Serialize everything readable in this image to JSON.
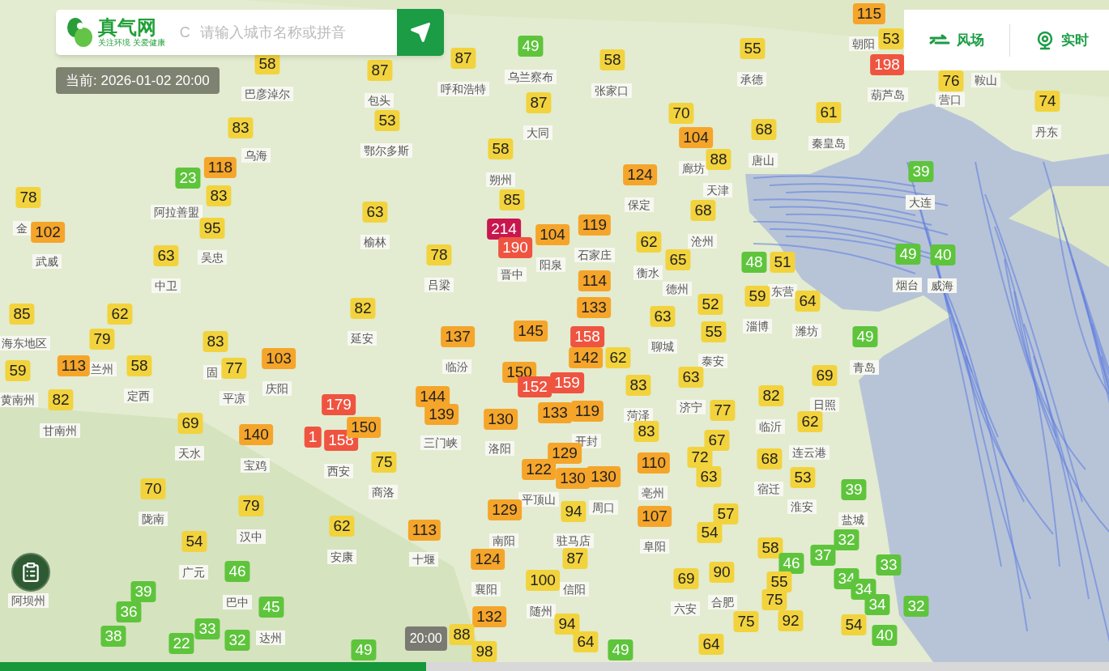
{
  "header": {
    "logo": "真气网",
    "tagline": "关注环境 关爱健康",
    "search_prefix": "C",
    "search_placeholder": "请输入城市名称或拼音"
  },
  "current_time": "当前: 2026-01-02 20:00",
  "toggles": [
    {
      "label": "风场",
      "kind": "wind"
    },
    {
      "label": "实时",
      "kind": "live"
    }
  ],
  "city_labels": [
    "朝阳",
    "乌兰察布",
    "承德",
    "鞍山",
    "巴彦淖尔",
    "包头",
    "呼和浩特",
    "张家口",
    "葫芦岛",
    "营口",
    "大同",
    "丹东",
    "秦皇岛",
    "乌海",
    "鄂尔多斯",
    "唐山",
    "廊坊",
    "朔州",
    "天津",
    "保定",
    "大连",
    "阿拉善盟",
    "金",
    "榆林",
    "沧州",
    "吴忠",
    "石家庄",
    "武威",
    "阳泉",
    "晋中",
    "衡水",
    "中卫",
    "吕梁",
    "德州",
    "东营",
    "烟台",
    "威海",
    "淄博",
    "潍坊",
    "海东地区",
    "延安",
    "聊城",
    "泰安",
    "兰州",
    "临汾",
    "青岛",
    "固",
    "庆阳",
    "黄南州",
    "定西",
    "平凉",
    "济宁",
    "日照",
    "菏泽",
    "临沂",
    "甘南州",
    "三门峡",
    "开封",
    "天水",
    "洛阳",
    "连云港",
    "宝鸡",
    "西安",
    "商洛",
    "亳州",
    "宿迁",
    "平顶山",
    "周口",
    "淮安",
    "陇南",
    "盐城",
    "汉中",
    "南阳",
    "驻马店",
    "阜阳",
    "安康",
    "十堰",
    "广元",
    "襄阳",
    "信阳",
    "阿坝州",
    "巴中",
    "合肥",
    "随州",
    "六安",
    "达州"
  ],
  "markers": [
    {
      "value": "115",
      "color": "#f5a52a"
    },
    {
      "value": "53",
      "color": "#f2d33d"
    },
    {
      "value": "49",
      "color": "#5ec43c"
    },
    {
      "value": "55",
      "color": "#f2d33d"
    },
    {
      "value": "58",
      "color": "#f2d33d"
    },
    {
      "value": "87",
      "color": "#f2d33d"
    },
    {
      "value": "87",
      "color": "#f2d33d"
    },
    {
      "value": "58",
      "color": "#f2d33d"
    },
    {
      "value": "198",
      "color": "#ef5440"
    },
    {
      "value": "76",
      "color": "#f2d33d"
    },
    {
      "value": "74",
      "color": "#f2d33d"
    },
    {
      "value": "87",
      "color": "#f2d33d"
    },
    {
      "value": "61",
      "color": "#f2d33d"
    },
    {
      "value": "70",
      "color": "#f2d33d"
    },
    {
      "value": "53",
      "color": "#f2d33d"
    },
    {
      "value": "83",
      "color": "#f2d33d"
    },
    {
      "value": "68",
      "color": "#f2d33d"
    },
    {
      "value": "104",
      "color": "#f5a52a"
    },
    {
      "value": "58",
      "color": "#f2d33d"
    },
    {
      "value": "88",
      "color": "#f2d33d"
    },
    {
      "value": "23",
      "color": "#5ec43c"
    },
    {
      "value": "118",
      "color": "#f5a52a"
    },
    {
      "value": "124",
      "color": "#f5a52a"
    },
    {
      "value": "39",
      "color": "#5ec43c"
    },
    {
      "value": "78",
      "color": "#f2d33d"
    },
    {
      "value": "83",
      "color": "#f2d33d"
    },
    {
      "value": "85",
      "color": "#f2d33d"
    },
    {
      "value": "63",
      "color": "#f2d33d"
    },
    {
      "value": "68",
      "color": "#f2d33d"
    },
    {
      "value": "102",
      "color": "#f5a52a"
    },
    {
      "value": "95",
      "color": "#f2d33d"
    },
    {
      "value": "214",
      "color": "#c8174f"
    },
    {
      "value": "104",
      "color": "#f5a52a"
    },
    {
      "value": "119",
      "color": "#f5a52a"
    },
    {
      "value": "190",
      "color": "#ef5440"
    },
    {
      "value": "62",
      "color": "#f2d33d"
    },
    {
      "value": "63",
      "color": "#f2d33d"
    },
    {
      "value": "78",
      "color": "#f2d33d"
    },
    {
      "value": "49",
      "color": "#5ec43c"
    },
    {
      "value": "40",
      "color": "#5ec43c"
    },
    {
      "value": "65",
      "color": "#f2d33d"
    },
    {
      "value": "48",
      "color": "#5ec43c"
    },
    {
      "value": "51",
      "color": "#f2d33d"
    },
    {
      "value": "114",
      "color": "#f5a52a"
    },
    {
      "value": "52",
      "color": "#f2d33d"
    },
    {
      "value": "59",
      "color": "#f2d33d"
    },
    {
      "value": "64",
      "color": "#f2d33d"
    },
    {
      "value": "85",
      "color": "#f2d33d"
    },
    {
      "value": "62",
      "color": "#f2d33d"
    },
    {
      "value": "82",
      "color": "#f2d33d"
    },
    {
      "value": "133",
      "color": "#f5a52a"
    },
    {
      "value": "63",
      "color": "#f2d33d"
    },
    {
      "value": "79",
      "color": "#f2d33d"
    },
    {
      "value": "83",
      "color": "#f2d33d"
    },
    {
      "value": "137",
      "color": "#f5a52a"
    },
    {
      "value": "145",
      "color": "#f5a52a"
    },
    {
      "value": "158",
      "color": "#ef5440"
    },
    {
      "value": "55",
      "color": "#f2d33d"
    },
    {
      "value": "49",
      "color": "#5ec43c"
    },
    {
      "value": "103",
      "color": "#f5a52a"
    },
    {
      "value": "142",
      "color": "#f5a52a"
    },
    {
      "value": "62",
      "color": "#f2d33d"
    },
    {
      "value": "59",
      "color": "#f2d33d"
    },
    {
      "value": "113",
      "color": "#f5a52a"
    },
    {
      "value": "58",
      "color": "#f2d33d"
    },
    {
      "value": "77",
      "color": "#f2d33d"
    },
    {
      "value": "150",
      "color": "#f5a52a"
    },
    {
      "value": "63",
      "color": "#f2d33d"
    },
    {
      "value": "69",
      "color": "#f2d33d"
    },
    {
      "value": "152",
      "color": "#ef5440"
    },
    {
      "value": "159",
      "color": "#ef5440"
    },
    {
      "value": "83",
      "color": "#f2d33d"
    },
    {
      "value": "82",
      "color": "#f2d33d"
    },
    {
      "value": "144",
      "color": "#f5a52a"
    },
    {
      "value": "82",
      "color": "#f2d33d"
    },
    {
      "value": "179",
      "color": "#ef5440"
    },
    {
      "value": "139",
      "color": "#f5a52a"
    },
    {
      "value": "133",
      "color": "#f5a52a"
    },
    {
      "value": "119",
      "color": "#f5a52a"
    },
    {
      "value": "77",
      "color": "#f2d33d"
    },
    {
      "value": "69",
      "color": "#f2d33d"
    },
    {
      "value": "130",
      "color": "#f5a52a"
    },
    {
      "value": "62",
      "color": "#f2d33d"
    },
    {
      "value": "140",
      "color": "#f5a52a"
    },
    {
      "value": "1",
      "color": "#ef5440"
    },
    {
      "value": "158",
      "color": "#ef5440"
    },
    {
      "value": "150",
      "color": "#f5a52a"
    },
    {
      "value": "83",
      "color": "#f2d33d"
    },
    {
      "value": "67",
      "color": "#f2d33d"
    },
    {
      "value": "75",
      "color": "#f2d33d"
    },
    {
      "value": "129",
      "color": "#f5a52a"
    },
    {
      "value": "110",
      "color": "#f5a52a"
    },
    {
      "value": "72",
      "color": "#f2d33d"
    },
    {
      "value": "68",
      "color": "#f2d33d"
    },
    {
      "value": "122",
      "color": "#f5a52a"
    },
    {
      "value": "130",
      "color": "#f5a52a"
    },
    {
      "value": "130",
      "color": "#f5a52a"
    },
    {
      "value": "63",
      "color": "#f2d33d"
    },
    {
      "value": "53",
      "color": "#f2d33d"
    },
    {
      "value": "70",
      "color": "#f2d33d"
    },
    {
      "value": "39",
      "color": "#5ec43c"
    },
    {
      "value": "79",
      "color": "#f2d33d"
    },
    {
      "value": "129",
      "color": "#f5a52a"
    },
    {
      "value": "94",
      "color": "#f2d33d"
    },
    {
      "value": "107",
      "color": "#f5a52a"
    },
    {
      "value": "57",
      "color": "#f2d33d"
    },
    {
      "value": "62",
      "color": "#f2d33d"
    },
    {
      "value": "113",
      "color": "#f5a52a"
    },
    {
      "value": "54",
      "color": "#f2d33d"
    },
    {
      "value": "54",
      "color": "#f2d33d"
    },
    {
      "value": "32",
      "color": "#5ec43c"
    },
    {
      "value": "58",
      "color": "#f2d33d"
    },
    {
      "value": "124",
      "color": "#f5a52a"
    },
    {
      "value": "87",
      "color": "#f2d33d"
    },
    {
      "value": "46",
      "color": "#5ec43c"
    },
    {
      "value": "37",
      "color": "#5ec43c"
    },
    {
      "value": "33",
      "color": "#5ec43c"
    },
    {
      "value": "46",
      "color": "#5ec43c"
    },
    {
      "value": "90",
      "color": "#f2d33d"
    },
    {
      "value": "100",
      "color": "#f2d33d"
    },
    {
      "value": "69",
      "color": "#f2d33d"
    },
    {
      "value": "55",
      "color": "#f2d33d"
    },
    {
      "value": "34",
      "color": "#5ec43c"
    },
    {
      "value": "39",
      "color": "#5ec43c"
    },
    {
      "value": "34",
      "color": "#5ec43c"
    },
    {
      "value": "45",
      "color": "#5ec43c"
    },
    {
      "value": "75",
      "color": "#f2d33d"
    },
    {
      "value": "34",
      "color": "#5ec43c"
    },
    {
      "value": "32",
      "color": "#5ec43c"
    },
    {
      "value": "36",
      "color": "#5ec43c"
    },
    {
      "value": "132",
      "color": "#f5a52a"
    },
    {
      "value": "94",
      "color": "#f2d33d"
    },
    {
      "value": "75",
      "color": "#f2d33d"
    },
    {
      "value": "92",
      "color": "#f2d33d"
    },
    {
      "value": "54",
      "color": "#f2d33d"
    },
    {
      "value": "38",
      "color": "#5ec43c"
    },
    {
      "value": "33",
      "color": "#5ec43c"
    },
    {
      "value": "88",
      "color": "#f2d33d"
    },
    {
      "value": "40",
      "color": "#5ec43c"
    },
    {
      "value": "22",
      "color": "#5ec43c"
    },
    {
      "value": "32",
      "color": "#5ec43c"
    },
    {
      "value": "64",
      "color": "#f2d33d"
    },
    {
      "value": "64",
      "color": "#f2d33d"
    },
    {
      "value": "49",
      "color": "#5ec43c"
    },
    {
      "value": "98",
      "color": "#f2d33d"
    },
    {
      "value": "49",
      "color": "#5ec43c"
    }
  ],
  "timeline": {
    "level": 0.384,
    "label": "20:00"
  }
}
